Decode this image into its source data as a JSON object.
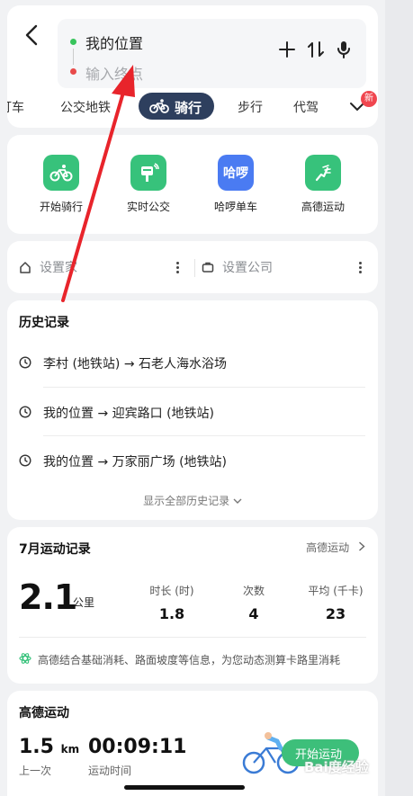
{
  "header": {
    "from_text": "我的位置",
    "to_placeholder": "输入终点",
    "tabs": [
      "打车",
      "公交地铁",
      "骑行",
      "步行",
      "代驾"
    ],
    "new_badge": "新"
  },
  "services": [
    {
      "label": "开始骑行",
      "icon": "bike-icon",
      "color": "#37c27b"
    },
    {
      "label": "实时公交",
      "icon": "bus-stop-icon",
      "color": "#37c27b"
    },
    {
      "label": "哈啰单车",
      "icon": "hello-logo",
      "logo_text": "哈啰",
      "color": "#4a7bf2"
    },
    {
      "label": "高德运动",
      "icon": "run-icon",
      "color": "#37c27b"
    }
  ],
  "places": {
    "home": "设置家",
    "work": "设置公司"
  },
  "history": {
    "title": "历史记录",
    "items": [
      "李村 (地铁站) → 石老人海水浴场",
      "我的位置 → 迎宾路口 (地铁站)",
      "我的位置 → 万家丽广场 (地铁站)"
    ],
    "show_all": "显示全部历史记录"
  },
  "monthly": {
    "title": "7月运动记录",
    "link": "高德运动",
    "distance": "2.1",
    "distance_unit": "公里",
    "stats": [
      {
        "label": "时长 (时)",
        "value": "1.8"
      },
      {
        "label": "次数",
        "value": "4"
      },
      {
        "label": "平均 (千卡)",
        "value": "23"
      }
    ],
    "note": "高德结合基础消耗、路面坡度等信息，为您动态测算卡路里消耗"
  },
  "sport": {
    "title": "高德运动",
    "last_value": "1.5",
    "last_unit": "km",
    "last_label": "上一次",
    "time_value": "00:09:11",
    "time_label": "运动时间",
    "start_button": "开始运动"
  },
  "watermark": "Bai度经验",
  "colors": {
    "accent_green": "#37c27b",
    "tab_active": "#2e3f5e",
    "annotation_arrow": "#e8242b"
  }
}
